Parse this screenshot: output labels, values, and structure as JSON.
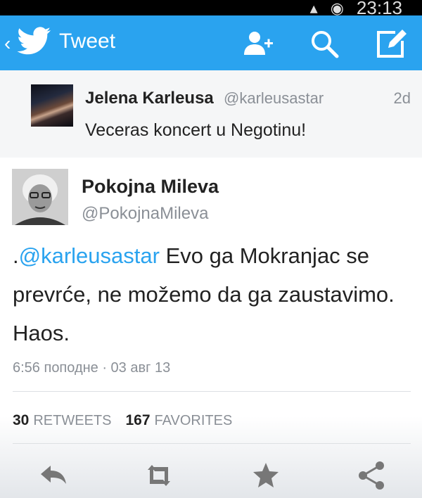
{
  "status_bar": {
    "time": "23:13"
  },
  "app_bar": {
    "title": "Tweet",
    "icons": [
      "back-chevron-icon",
      "twitter-bird-icon",
      "add-user-icon",
      "search-icon",
      "compose-icon"
    ]
  },
  "reply_context": {
    "name": "Jelena Karleusa",
    "handle": "@karleusastar",
    "time": "2d",
    "text": "Veceras koncert u Negotinu!"
  },
  "tweet": {
    "name": "Pokojna Mileva",
    "handle": "@PokojnaMileva",
    "text_prefix": ".",
    "mention": "@karleusastar",
    "text_body": " Evo ga Mokranjac se prevrće, ne možemo da ga zaustavimo. Haos.",
    "timestamp": "6:56 поподне · 03 авг 13",
    "retweets_count": "30",
    "retweets_label": "RETWEETS",
    "favorites_count": "167",
    "favorites_label": "FAVORITES"
  },
  "colors": {
    "accent": "#2aa3ef",
    "text": "#222222",
    "muted": "#8a8f96"
  },
  "action_icons": [
    "reply-icon",
    "retweet-icon",
    "favorite-star-icon",
    "share-icon"
  ]
}
